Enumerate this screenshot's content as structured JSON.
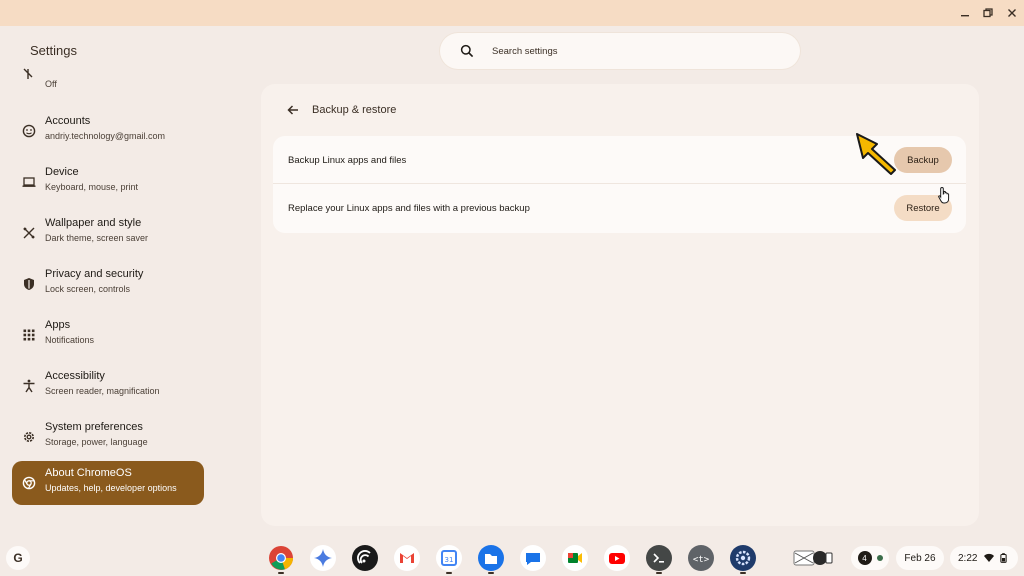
{
  "window": {
    "controls": [
      "minimize-icon",
      "restore-icon",
      "close-icon"
    ]
  },
  "app": {
    "title": "Settings"
  },
  "search": {
    "placeholder": "Search settings"
  },
  "sidebar": {
    "partial_item": {
      "subtitle": "Off"
    },
    "items": [
      {
        "icon": "account-icon",
        "title": "Accounts",
        "subtitle": "andriy.technology@gmail.com"
      },
      {
        "icon": "laptop-icon",
        "title": "Device",
        "subtitle": "Keyboard, mouse, print"
      },
      {
        "icon": "palette-icon",
        "title": "Wallpaper and style",
        "subtitle": "Dark theme, screen saver"
      },
      {
        "icon": "shield-icon",
        "title": "Privacy and security",
        "subtitle": "Lock screen, controls"
      },
      {
        "icon": "apps-grid-icon",
        "title": "Apps",
        "subtitle": "Notifications"
      },
      {
        "icon": "accessibility-icon",
        "title": "Accessibility",
        "subtitle": "Screen reader, magnification"
      },
      {
        "icon": "gear-icon",
        "title": "System preferences",
        "subtitle": "Storage, power, language"
      },
      {
        "icon": "chromeos-icon",
        "title": "About ChromeOS",
        "subtitle": "Updates, help, developer options",
        "active": true
      }
    ]
  },
  "main": {
    "title": "Backup & restore",
    "rows": [
      {
        "label": "Backup Linux apps and files",
        "button": "Backup"
      },
      {
        "label": "Replace your Linux apps and files with a previous backup",
        "button": "Restore"
      }
    ]
  },
  "shelf": {
    "launcher_label": "G",
    "apps": [
      "chrome-icon",
      "gemini-icon",
      "podcast-icon",
      "gmail-icon",
      "calendar-icon",
      "files-icon",
      "messages-icon",
      "meet-icon",
      "youtube-icon",
      "terminal-icon",
      "text-editor-icon",
      "settings-icon"
    ],
    "notification_count": "4",
    "date": "Feb 26",
    "time": "2:22"
  },
  "colors": {
    "accent": "#8a5a1d",
    "button_bg": "#f4dcc5",
    "titlebar": "#f6dcc4"
  }
}
